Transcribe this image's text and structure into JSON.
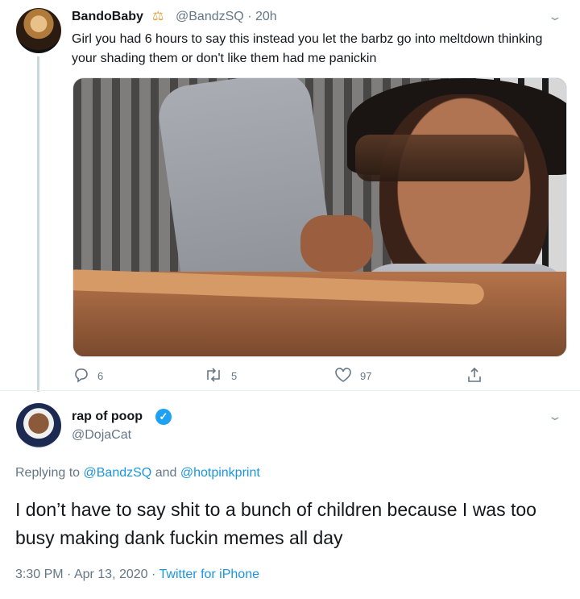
{
  "tweet1": {
    "display_name": "BandoBaby",
    "badge": "⚖",
    "handle": "@BandzSQ",
    "separator": "·",
    "time": "20h",
    "text": "Girl you had 6 hours to say this instead you let the barbz go into meltdown thinking your shading them or don't like them had me panickin",
    "media": {
      "type": "gif",
      "description_icon": "gif-media"
    },
    "actions": {
      "reply_count": "6",
      "retweet_count": "5",
      "like_count": "97"
    }
  },
  "tweet2": {
    "display_name": "rap of poop",
    "verified": "✓",
    "handle": "@DojaCat",
    "replying_prefix": "Replying to",
    "replying_user1": "@BandzSQ",
    "replying_and": "and",
    "replying_user2": "@hotpinkprint",
    "text": "I don’t have to say shit to a bunch of children because I was too busy making dank fuckin memes all day",
    "time": "3:30 PM",
    "dot": "·",
    "date": "Apr 13, 2020",
    "source": "Twitter for iPhone"
  },
  "icons": {
    "chevron": "chevron-down-icon",
    "reply": "reply-icon",
    "retweet": "retweet-icon",
    "like": "heart-icon",
    "share": "share-icon"
  },
  "colors": {
    "link": "#1b95e0",
    "muted": "#657786",
    "verified": "#1da1f2",
    "text": "#14171a"
  }
}
